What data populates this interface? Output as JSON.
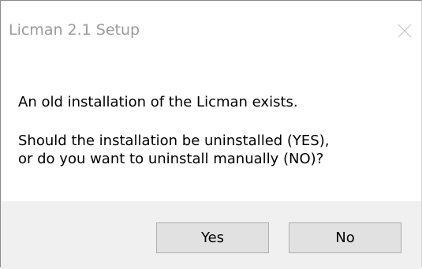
{
  "window": {
    "title": "Licman 2.1 Setup",
    "close_icon": "close-icon"
  },
  "message": {
    "line1": "An old installation of the Licman exists.",
    "line2": "Should the installation be uninstalled (YES),",
    "line3": "or do you want to uninstall manually (NO)?"
  },
  "buttons": {
    "yes_label": "Yes",
    "no_label": "No"
  },
  "colors": {
    "title_text": "#9b9b9b",
    "footer_bg": "#f0f0f0",
    "button_bg": "#e1e1e1",
    "button_border": "#adadad"
  }
}
